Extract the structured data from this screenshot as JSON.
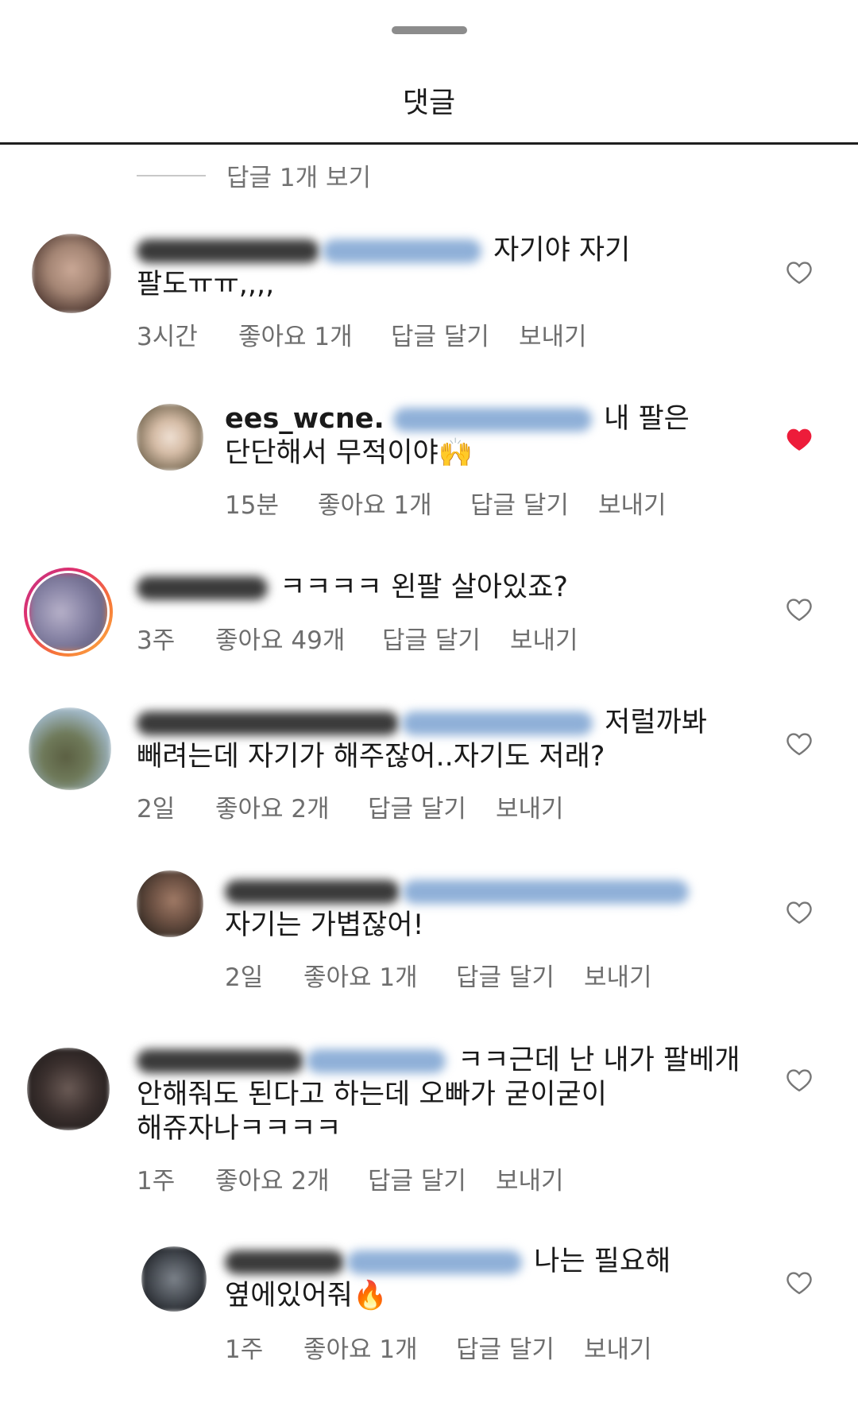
{
  "header": {
    "title": "댓글"
  },
  "view_replies_label": "답글 1개 보기",
  "colors": {
    "like_active": "#ed1c3a",
    "meta_text": "#6e6e6e"
  },
  "comments": [
    {
      "text_line1": "자기야 자기",
      "text_line2": "팔도ㅠㅠ,,,,",
      "time": "3시간",
      "likes": "좋아요 1개",
      "reply": "답글 달기",
      "send": "보내기",
      "liked": false
    },
    {
      "username_partial": "ees_wcne.",
      "text_line1": "내 팔은",
      "text_line2": "단단해서 무적이야🙌",
      "time": "15분",
      "likes": "좋아요 1개",
      "reply": "답글 달기",
      "send": "보내기",
      "liked": true
    },
    {
      "text_line1": "ㅋㅋㅋㅋ 왼팔 살아있죠?",
      "time": "3주",
      "likes": "좋아요 49개",
      "reply": "답글 달기",
      "send": "보내기",
      "liked": false
    },
    {
      "text_line1": "저럴까봐",
      "text_line2": "빼려는데 자기가 해주잖어..자기도 저래?",
      "time": "2일",
      "likes": "좋아요 2개",
      "reply": "답글 달기",
      "send": "보내기",
      "liked": false
    },
    {
      "text_line2": "자기는 가볍잖어!",
      "time": "2일",
      "likes": "좋아요 1개",
      "reply": "답글 달기",
      "send": "보내기",
      "liked": false
    },
    {
      "text_line1": "ㅋㅋ근데 난 내가 팔베개",
      "text_line2": "안해줘도 된다고 하는데 오빠가 굳이굳이",
      "text_line3": "해쥬자나ㅋㅋㅋㅋ",
      "time": "1주",
      "likes": "좋아요 2개",
      "reply": "답글 달기",
      "send": "보내기",
      "liked": false
    },
    {
      "text_line1": "나는 필요해",
      "text_line2": "옆에있어줘🔥",
      "time": "1주",
      "likes": "좋아요 1개",
      "reply": "답글 달기",
      "send": "보내기",
      "liked": false
    }
  ]
}
